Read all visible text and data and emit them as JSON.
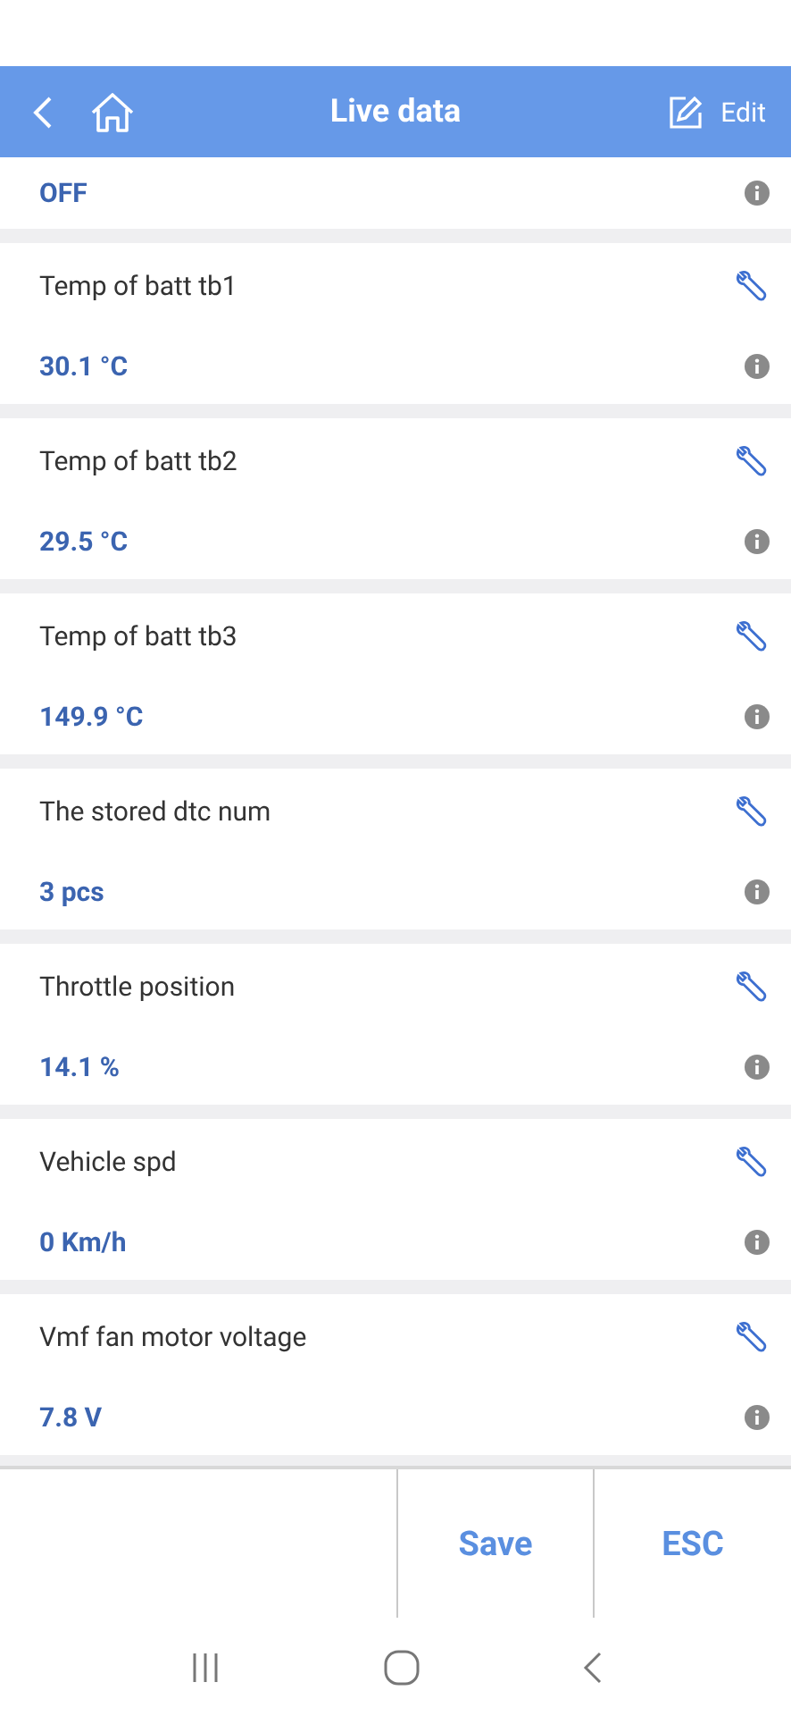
{
  "header": {
    "title": "Live data",
    "edit_label": "Edit"
  },
  "items": [
    {
      "value": "OFF"
    },
    {
      "name": "Temp of batt tb1",
      "value": "30.1 °C"
    },
    {
      "name": "Temp of batt tb2",
      "value": "29.5 °C"
    },
    {
      "name": "Temp of batt tb3",
      "value": "149.9 °C"
    },
    {
      "name": "The stored dtc num",
      "value": "3 pcs"
    },
    {
      "name": "Throttle position",
      "value": "14.1 %"
    },
    {
      "name": "Vehicle spd",
      "value": "0 Km/h"
    },
    {
      "name": "Vmf fan motor voltage",
      "value": "7.8 V"
    }
  ],
  "footer": {
    "buttons": [
      "Save",
      "ESC"
    ]
  }
}
